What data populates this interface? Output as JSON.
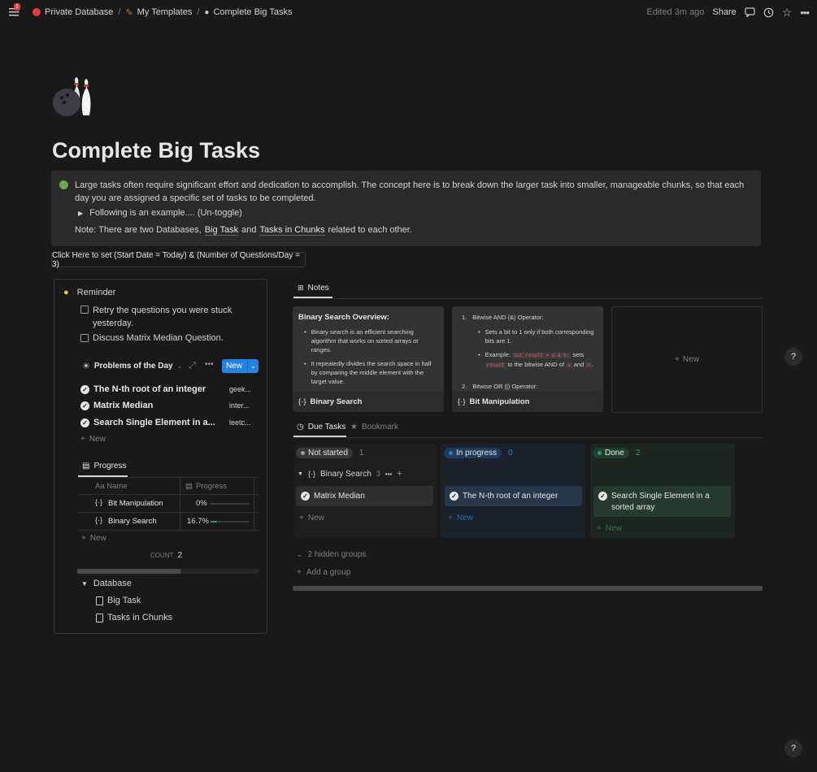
{
  "topbar": {
    "notification_count": "1",
    "breadcrumbs": [
      "Private Database",
      "My Templates",
      "Complete Big Tasks"
    ],
    "edited": "Edited 3m ago",
    "share": "Share"
  },
  "page": {
    "title": "Complete Big Tasks",
    "callout": {
      "text": "Large tasks often require significant effort and dedication to accomplish. The concept here is to break down the larger task into smaller, manageable chunks, so that each day you are assigned a specific set of tasks to be completed.",
      "toggle": "Following is an example.... (Un-toggle)",
      "note_prefix": "Note: There are two Databases,",
      "note_db1": "Big Task",
      "note_and": "and",
      "note_db2": "Tasks in Chunks",
      "note_suffix": "related to each other."
    },
    "template_button": "Click Here to set (Start Date = Today) & (Number of Questions/Day = 3)"
  },
  "left": {
    "reminder": "Reminder",
    "todos": [
      "Retry the questions you were stuck yesterday.",
      "Discuss Matrix Median Question."
    ],
    "potd": {
      "title": "Problems of the Day",
      "new": "New",
      "rows": [
        {
          "name": "The N-th root of an integer",
          "source": "geek..."
        },
        {
          "name": "Matrix Median",
          "source": "inter..."
        },
        {
          "name": "Search Single Element in a...",
          "source": "leetc..."
        }
      ],
      "add": "New"
    },
    "progress": {
      "tab": "Progress",
      "col_name": "Aa Name",
      "col_progress": "Progress",
      "rows": [
        {
          "name": "Bit Manipulation",
          "value": "0%",
          "fraction": 0
        },
        {
          "name": "Binary Search",
          "value": "16.7%",
          "fraction": 0.167
        }
      ],
      "add": "New",
      "count_label": "COUNT",
      "count": "2"
    },
    "database": {
      "title": "Database",
      "items": [
        "Big Task",
        "Tasks in Chunks"
      ]
    }
  },
  "notes": {
    "tab": "Notes",
    "card1": {
      "heading": "Binary Search Overview:",
      "bullets": [
        "Binary search is an efficient searching algorithm that works on sorted arrays or ranges.",
        "It repeatedly divides the search space in half by comparing the middle element with the target value."
      ],
      "footer": "Binary Search"
    },
    "card2": {
      "item1": "Bitwise AND (&) Operator:",
      "sub1": "Sets a bit to 1 only if both corresponding bits are 1.",
      "ex_prefix": "Example:",
      "ex_code1": "int result = a & b;",
      "ex_mid": "sets",
      "ex_code2": "result",
      "ex_mid2": "to the bitwise AND of",
      "ex_code3": "a",
      "ex_and": "and",
      "ex_code4": "b",
      "ex_end": ".",
      "item2": "Bitwise OR (|) Operator:",
      "footer": "Bit Manipulation"
    },
    "new_card": "New"
  },
  "tasks": {
    "tab_due": "Due Tasks",
    "tab_bookmark": "Bookmark",
    "columns": [
      {
        "status": "Not started",
        "count": "1",
        "color": "#9b9b9b",
        "bg": "#373737"
      },
      {
        "status": "In progress",
        "count": "0",
        "color": "#2e7cd1",
        "bg": "#1f3a5a"
      },
      {
        "status": "Done",
        "count": "2",
        "color": "#2d9964",
        "bg": "#1f4030"
      }
    ],
    "group": {
      "name": "Binary Search",
      "count": "3"
    },
    "cards": [
      "Matrix Median",
      "The N-th root of an integer",
      "Search Single Element in a sorted array"
    ],
    "new": "New",
    "hidden_groups": "2 hidden groups",
    "add_group": "Add a group"
  },
  "help": "?"
}
